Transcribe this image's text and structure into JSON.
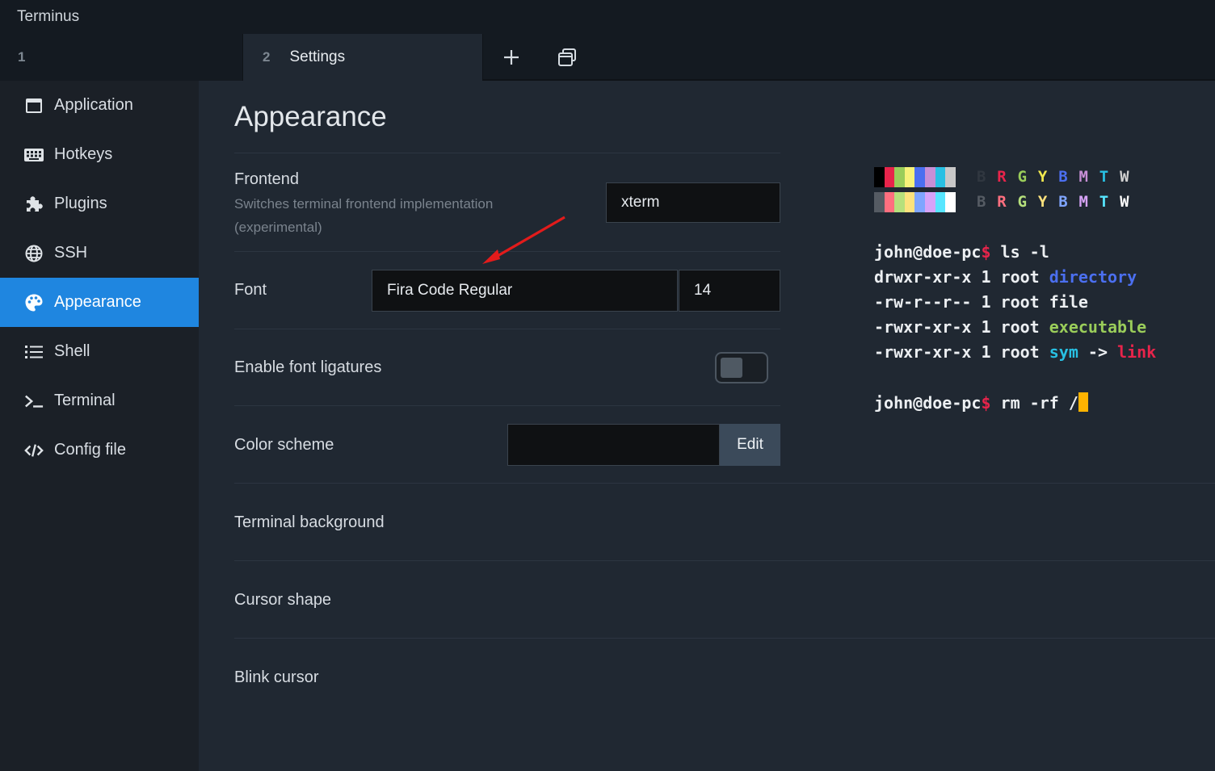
{
  "window": {
    "title": "Terminus"
  },
  "tabs": [
    {
      "num": "1",
      "label": ""
    },
    {
      "num": "2",
      "label": "Settings"
    }
  ],
  "sidebar": {
    "items": [
      {
        "label": "Application",
        "icon": "window-icon"
      },
      {
        "label": "Hotkeys",
        "icon": "keyboard-icon"
      },
      {
        "label": "Plugins",
        "icon": "puzzle-icon"
      },
      {
        "label": "SSH",
        "icon": "globe-icon"
      },
      {
        "label": "Appearance",
        "icon": "palette-icon",
        "active": true
      },
      {
        "label": "Shell",
        "icon": "list-icon"
      },
      {
        "label": "Terminal",
        "icon": "terminal-icon"
      },
      {
        "label": "Config file",
        "icon": "code-icon"
      }
    ]
  },
  "main": {
    "title": "Appearance",
    "frontend": {
      "label": "Frontend",
      "description": "Switches terminal frontend implementation (experimental)",
      "value": "xterm"
    },
    "font": {
      "label": "Font",
      "family": "Fira Code Regular",
      "size": "14"
    },
    "ligatures": {
      "label": "Enable font ligatures",
      "enabled": false
    },
    "color_scheme": {
      "label": "Color scheme",
      "value": "",
      "edit_label": "Edit"
    },
    "terminal_background": {
      "label": "Terminal background"
    },
    "cursor_shape": {
      "label": "Cursor shape"
    },
    "blink_cursor": {
      "label": "Blink cursor"
    }
  },
  "preview": {
    "palette_normal": [
      "#000000",
      "#e8244b",
      "#9acd5a",
      "#f7f27a",
      "#4b6ff0",
      "#c88fd6",
      "#28c0e3",
      "#c8c8c8"
    ],
    "palette_bright": [
      "#555b63",
      "#ff6f7f",
      "#b6e07c",
      "#fce27d",
      "#7fa5ff",
      "#d7a3f8",
      "#57e6ff",
      "#ffffff"
    ],
    "letters": [
      "B",
      "R",
      "G",
      "Y",
      "B",
      "M",
      "T",
      "W"
    ],
    "letter_colors_normal": [
      "#303740",
      "#e8244b",
      "#9acd5a",
      "#f0e84f",
      "#4b6ff0",
      "#c88fd6",
      "#28c0e3",
      "#d0d0d0"
    ],
    "letter_colors_bright": [
      "#555b63",
      "#ff6f7f",
      "#b6e07c",
      "#fce27d",
      "#7fa5ff",
      "#d7a3f8",
      "#57e6ff",
      "#ffffff"
    ],
    "prompt": "john@doe-pc",
    "prompt_symbol": "$",
    "command1": " ls -l",
    "lines": [
      {
        "perms": "drwxr-xr-x 1 root ",
        "name": "directory",
        "color": "#4b6ff0"
      },
      {
        "perms": "-rw-r--r-- 1 root ",
        "name": "file",
        "color": "#eceff2"
      },
      {
        "perms": "-rwxr-xr-x 1 root ",
        "name": "executable",
        "color": "#9acd5a"
      }
    ],
    "symline": {
      "perms": "-rwxr-xr-x 1 root ",
      "sym": "sym",
      "arrow": " -> ",
      "target": "link"
    },
    "command2": " rm -rf /"
  }
}
